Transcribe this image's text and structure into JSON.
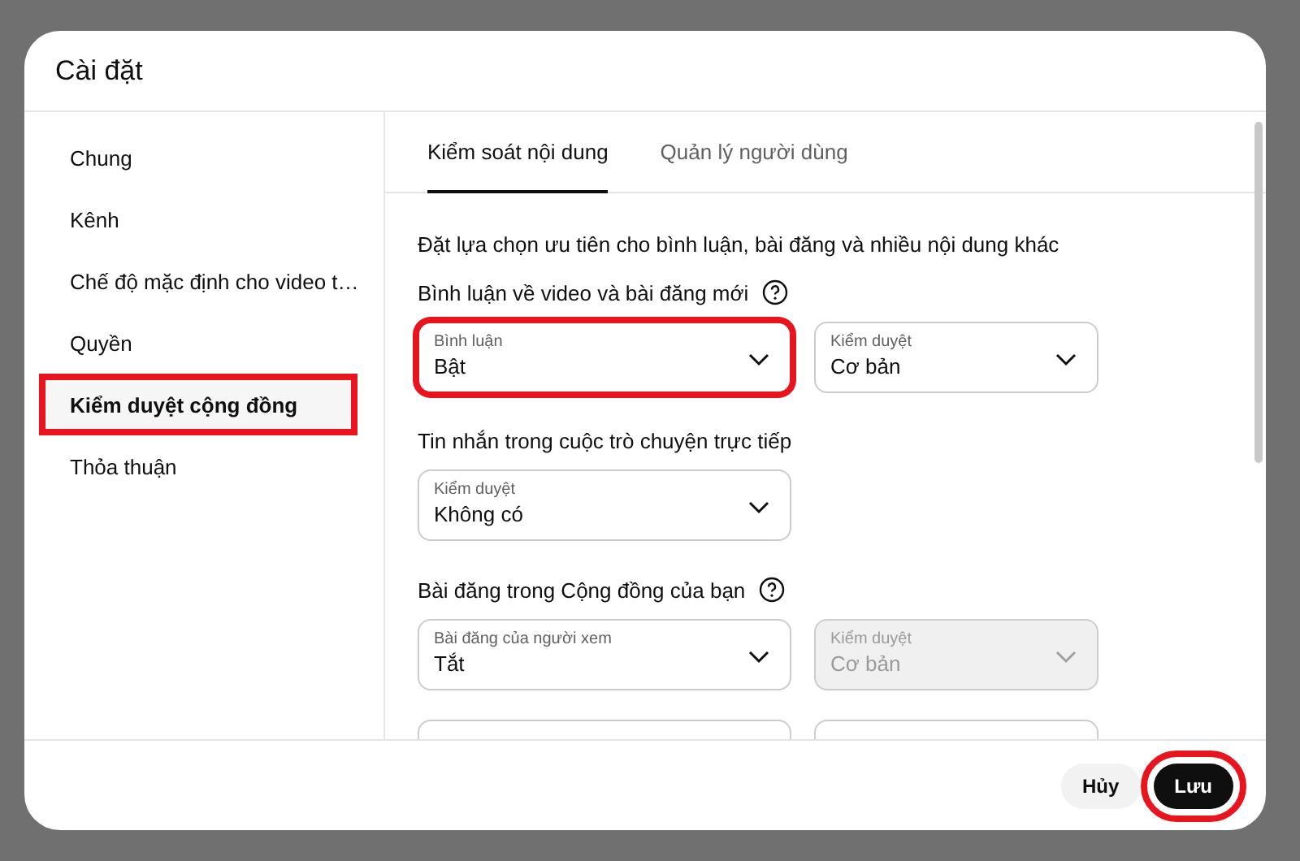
{
  "dialog": {
    "title": "Cài đặt",
    "nav": [
      {
        "label": "Chung",
        "selected": false,
        "highlighted": false
      },
      {
        "label": "Kênh",
        "selected": false,
        "highlighted": false
      },
      {
        "label": "Chế độ mặc định cho video t…",
        "selected": false,
        "highlighted": false
      },
      {
        "label": "Quyền",
        "selected": false,
        "highlighted": false
      },
      {
        "label": "Kiểm duyệt cộng đồng",
        "selected": true,
        "highlighted": true
      },
      {
        "label": "Thỏa thuận",
        "selected": false,
        "highlighted": false
      }
    ],
    "tabs": [
      {
        "label": "Kiểm soát nội dung",
        "selected": true
      },
      {
        "label": "Quản lý người dùng",
        "selected": false
      }
    ],
    "description": "Đặt lựa chọn ưu tiên cho bình luận, bài đăng và nhiều nội dung khác",
    "sections": [
      {
        "heading": "Bình luận về video và bài đăng mới",
        "help": true,
        "fields": [
          {
            "label": "Bình luận",
            "value": "Bật",
            "disabled": false,
            "highlighted": true
          },
          {
            "label": "Kiểm duyệt",
            "value": "Cơ bản",
            "disabled": false,
            "highlighted": false
          }
        ]
      },
      {
        "heading": "Tin nhắn trong cuộc trò chuyện trực tiếp",
        "help": false,
        "fields": [
          {
            "label": "Kiểm duyệt",
            "value": "Không có",
            "disabled": false,
            "highlighted": false
          }
        ]
      },
      {
        "heading": "Bài đăng trong Cộng đồng của bạn",
        "help": true,
        "fields": [
          {
            "label": "Bài đăng của người xem",
            "value": "Tắt",
            "disabled": false,
            "highlighted": false
          },
          {
            "label": "Kiểm duyệt",
            "value": "Cơ bản",
            "disabled": true,
            "highlighted": false
          }
        ]
      }
    ],
    "buttons": [
      {
        "label": "Hủy",
        "kind": "secondary",
        "highlighted": false
      },
      {
        "label": "Lưu",
        "kind": "primary",
        "highlighted": true
      }
    ]
  }
}
